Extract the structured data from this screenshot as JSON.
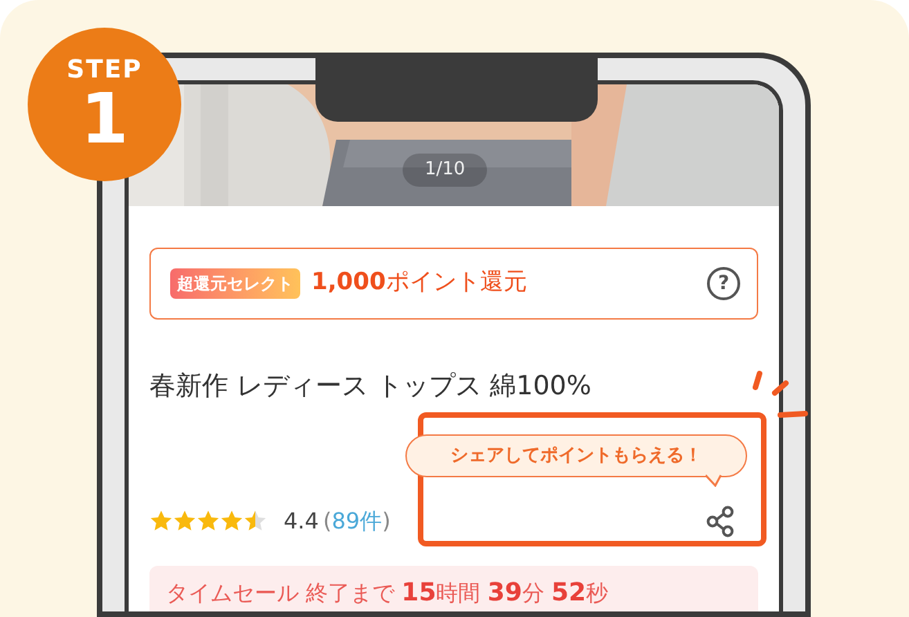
{
  "step_badge": {
    "label": "STEP",
    "number": "1"
  },
  "product": {
    "photo": {
      "page_indicator": "1/10"
    },
    "promo": {
      "tag": "超還元セレクト",
      "text": "**1,000**ポイント還元",
      "help_icon": "?"
    },
    "title": "春新作 レディース トップス 綿100%",
    "share_tooltip": "シェアしてポイントもらえる！",
    "rating": {
      "stars": 4.5,
      "score": "4.4",
      "open": "(",
      "count": "89件",
      "close": ")"
    },
    "time_sale": "タイムセール 終了まで **15**時間 **39**分 **52**秒"
  }
}
